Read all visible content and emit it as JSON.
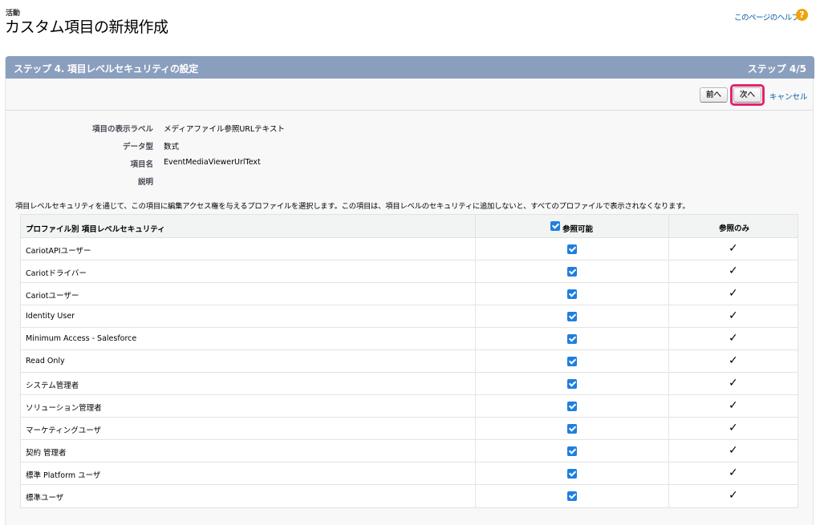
{
  "header": {
    "breadcrumb": "活動",
    "title": "カスタム項目の新規作成",
    "help_link": "このページのヘルプ",
    "help_icon": "help-icon"
  },
  "panel": {
    "step_title": "ステップ 4. 項目レベルセキュリティの設定",
    "step_count": "ステップ 4/5",
    "buttons": {
      "prev": "前へ",
      "next": "次へ",
      "cancel": "キャンセル"
    }
  },
  "details": [
    {
      "label": "項目の表示ラベル",
      "value": "メディアファイル参照URLテキスト"
    },
    {
      "label": "データ型",
      "value": "数式"
    },
    {
      "label": "項目名",
      "value": "EventMediaViewerUrlText"
    },
    {
      "label": "説明",
      "value": ""
    }
  ],
  "description": "項目レベルセキュリティを通じて、この項目に編集アクセス権を与えるプロファイルを選択します。この項目は、項目レベルのセキュリティに追加しないと、すべてのプロファイルで表示されなくなります。",
  "table": {
    "headers": {
      "profile": "プロファイル別 項目レベルセキュリティ",
      "readable": "参照可能",
      "read_only": "参照のみ"
    },
    "rows": [
      {
        "name": "CariotAPIユーザー",
        "readable": true,
        "read_only": true
      },
      {
        "name": "Cariotドライバー",
        "readable": true,
        "read_only": true
      },
      {
        "name": "Cariotユーザー",
        "readable": true,
        "read_only": true
      },
      {
        "name": "Identity User",
        "readable": true,
        "read_only": true
      },
      {
        "name": "Minimum Access - Salesforce",
        "readable": true,
        "read_only": true
      },
      {
        "name": "Read Only",
        "readable": true,
        "read_only": true
      },
      {
        "name": "システム管理者",
        "readable": true,
        "read_only": true
      },
      {
        "name": "ソリューション管理者",
        "readable": true,
        "read_only": true
      },
      {
        "name": "マーケティングユーザ",
        "readable": true,
        "read_only": true
      },
      {
        "name": "契約 管理者",
        "readable": true,
        "read_only": true
      },
      {
        "name": "標準 Platform ユーザ",
        "readable": true,
        "read_only": true
      },
      {
        "name": "標準ユーザ",
        "readable": true,
        "read_only": true
      }
    ]
  },
  "colors": {
    "header_bar": "#8a9ebe",
    "link": "#015ba7",
    "highlight": "#e2256f",
    "checkbox": "#1f7fe0"
  }
}
